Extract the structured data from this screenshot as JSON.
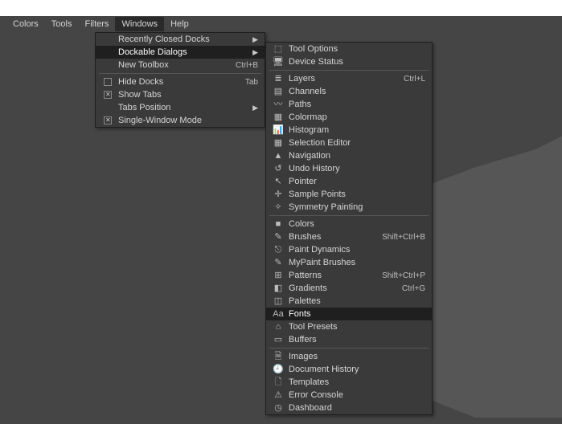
{
  "menubar": {
    "items": [
      "Colors",
      "Tools",
      "Filters",
      "Windows",
      "Help"
    ],
    "open_index": 3
  },
  "windows_menu": {
    "items": [
      {
        "label": "Recently Closed Docks",
        "submenu": true
      },
      {
        "label": "Dockable Dialogs",
        "submenu": true,
        "highlight": true
      },
      {
        "label": "New Toolbox",
        "accel": "Ctrl+B"
      }
    ],
    "items2": [
      {
        "label": "Hide Docks",
        "accel": "Tab",
        "check": "unchecked"
      },
      {
        "label": "Show Tabs",
        "check": "checked"
      },
      {
        "label": "Tabs Position",
        "submenu": true
      },
      {
        "label": "Single-Window Mode",
        "check": "checked"
      }
    ]
  },
  "dockable_menu": {
    "group1": [
      {
        "icon": "⬚",
        "label": "Tool Options"
      },
      {
        "icon": "🖥",
        "label": "Device Status"
      }
    ],
    "group2": [
      {
        "icon": "≣",
        "label": "Layers",
        "accel": "Ctrl+L"
      },
      {
        "icon": "▤",
        "label": "Channels"
      },
      {
        "icon": "〰",
        "label": "Paths"
      },
      {
        "icon": "▦",
        "label": "Colormap"
      },
      {
        "icon": "📊",
        "label": "Histogram"
      },
      {
        "icon": "▦",
        "label": "Selection Editor"
      },
      {
        "icon": "▲",
        "label": "Navigation"
      },
      {
        "icon": "↺",
        "label": "Undo History"
      },
      {
        "icon": "↖",
        "label": "Pointer"
      },
      {
        "icon": "✛",
        "label": "Sample Points"
      },
      {
        "icon": "✧",
        "label": "Symmetry Painting"
      }
    ],
    "group3": [
      {
        "icon": "■",
        "label": "Colors"
      },
      {
        "icon": "✎",
        "label": "Brushes",
        "accel": "Shift+Ctrl+B"
      },
      {
        "icon": "⎋",
        "label": "Paint Dynamics"
      },
      {
        "icon": "✎",
        "label": "MyPaint Brushes"
      },
      {
        "icon": "⊞",
        "label": "Patterns",
        "accel": "Shift+Ctrl+P"
      },
      {
        "icon": "◧",
        "label": "Gradients",
        "accel": "Ctrl+G"
      },
      {
        "icon": "◫",
        "label": "Palettes"
      },
      {
        "icon": "Aa",
        "label": "Fonts",
        "highlight": true
      },
      {
        "icon": "⌂",
        "label": "Tool Presets"
      },
      {
        "icon": "▭",
        "label": "Buffers"
      }
    ],
    "group4": [
      {
        "icon": "🗎",
        "label": "Images"
      },
      {
        "icon": "🕘",
        "label": "Document History"
      },
      {
        "icon": "🗋",
        "label": "Templates"
      },
      {
        "icon": "⚠",
        "label": "Error Console"
      },
      {
        "icon": "◷",
        "label": "Dashboard"
      }
    ]
  }
}
